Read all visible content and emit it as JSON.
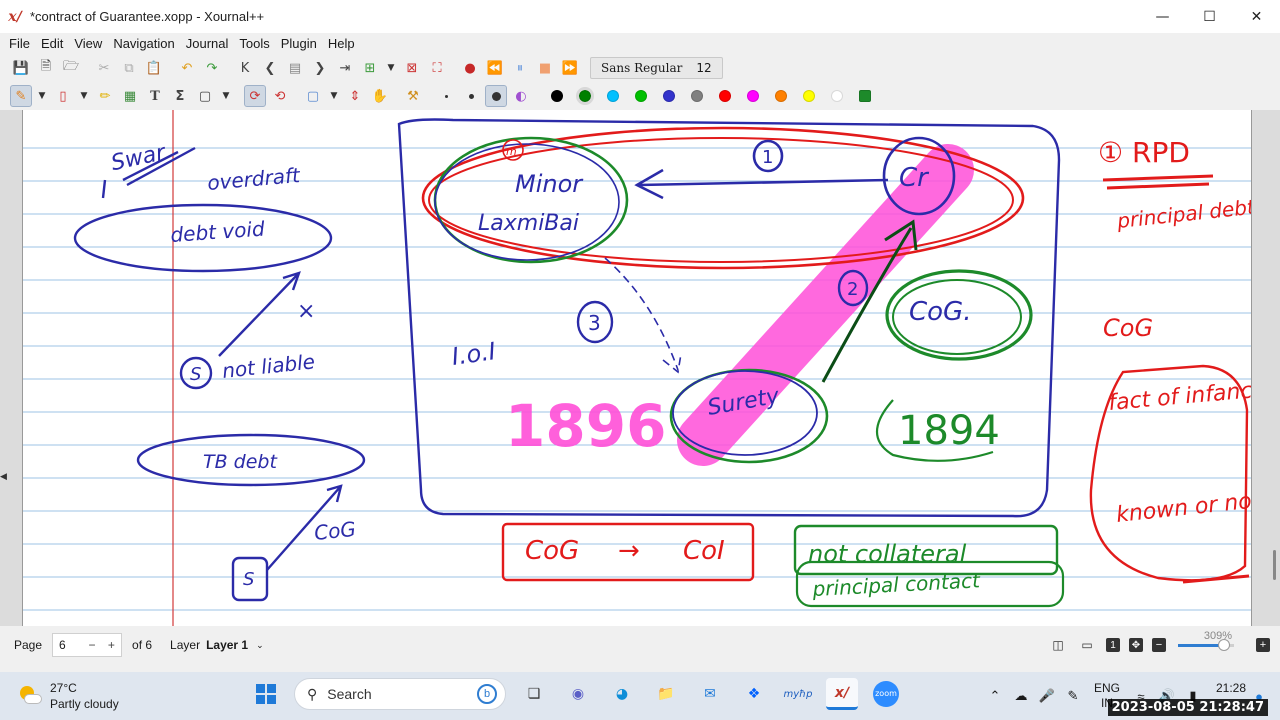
{
  "window": {
    "title": "*contract of Guarantee.xopp - Xournal++",
    "app_icon": "xournal-icon"
  },
  "menu": [
    "File",
    "Edit",
    "View",
    "Navigation",
    "Journal",
    "Tools",
    "Plugin",
    "Help"
  ],
  "toolbar": {
    "font_name": "Sans Regular",
    "font_size": "12",
    "colors": [
      "#000000",
      "#008000",
      "#00c0ff",
      "#00c000",
      "#3333cc",
      "#808080",
      "#ff0000",
      "#ff00ff",
      "#ff8000",
      "#ffff00",
      "#ffffff",
      "#1d8a2a"
    ],
    "selected_color": "#008000"
  },
  "notes": {
    "swar": "Swar",
    "overdraft": "overdraft",
    "debt_void": "debt void",
    "cross": "×",
    "s1": "S",
    "not_liable": "not liable",
    "tb_debt": "TB debt",
    "s2": "S",
    "cog_left": "CoG",
    "minor_tag": "m",
    "minor": "Minor",
    "laxmibai": "LaxmiBai",
    "num1": "1",
    "cr": "Cr",
    "num2": "2",
    "num3": "3",
    "ioi": "I.o.I",
    "surety": "Surety",
    "cog_mid": "CoG.",
    "year_pink": "1896",
    "year": "1894",
    "cog_box": "CoG",
    "arrow": "→",
    "coi_box": "CoI",
    "not_collateral": "not collateral",
    "principal_contract": "principal contact",
    "orpd": "① RPD",
    "principal_debtor": "principal debtor",
    "cog_right": "CoG",
    "fact_of_infancy": "fact of infancy",
    "known_or_not": "known or not"
  },
  "status": {
    "page_label": "Page",
    "page_value": "6",
    "page_minus": "−",
    "page_plus": "+",
    "of_pages": "of 6",
    "layer_label": "Layer",
    "layer_value": "Layer 1",
    "zoom": "309%",
    "zoom_fraction": 0.82
  },
  "taskbar": {
    "temp": "27°C",
    "weather": "Partly cloudy",
    "search": "Search",
    "lang1": "ENG",
    "lang2": "IN",
    "time": "21:28",
    "date": "2023-08-05 21:28:47"
  }
}
